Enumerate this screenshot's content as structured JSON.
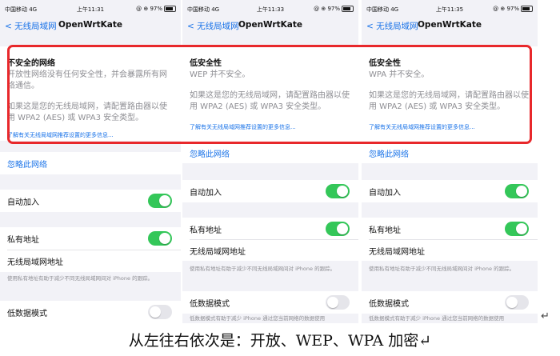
{
  "caption": "从左往右依次是：开放、WEP、WPA 加密↵",
  "return_mark": "↵",
  "colors": {
    "accent": "#1a73e8",
    "toggle_on": "#34c759",
    "highlight": "#e8282b"
  },
  "panels": [
    {
      "status": {
        "carrier": "中国移动 4G",
        "time": "上午11:31",
        "battery": "@ ⊕ 97%"
      },
      "nav": {
        "back": "< 无线局域网",
        "title": "OpenWrtKate"
      },
      "info": {
        "heading": "不安全的网络",
        "para1": "开放性网络没有任何安全性，并会暴露所有网络通信。",
        "para2": "如果这是您的无线局域网，请配置路由器以使用 WPA2 (AES) 或 WPA3 安全类型。",
        "link": "了解有关无线局域网推荐设置的更多信息..."
      },
      "ignore": "忽略此网络",
      "auto_join": "自动加入",
      "private_address": "私有地址",
      "wlan_address": "无线局域网地址",
      "private_note": "使用私有地址有助于减少不同无线局域网间对 iPhone 的跟踪。",
      "low_data": "低数据模式"
    },
    {
      "status": {
        "carrier": "中国移动 4G",
        "time": "上午11:33",
        "battery": "@ ⊕ 97%"
      },
      "nav": {
        "back": "< 无线局域网",
        "title": "OpenWrtKate"
      },
      "info": {
        "heading": "低安全性",
        "para1": "WEP 并不安全。",
        "para2": "如果这是您的无线局域网，请配置路由器以使用 WPA2 (AES) 或 WPA3 安全类型。",
        "link": "了解有关无线局域网推荐设置的更多信息..."
      },
      "ignore": "忽略此网络",
      "auto_join": "自动加入",
      "private_address": "私有地址",
      "wlan_address": "无线局域网地址",
      "private_note": "使用私有地址有助于减少不同无线局域网间对 iPhone 的跟踪。",
      "low_data": "低数据模式",
      "low_data_note": "低数据模式有助于减少 iPhone 通过您当前网络的数据使用"
    },
    {
      "status": {
        "carrier": "中国移动 4G",
        "time": "上午11:35",
        "battery": "@ ⊕ 97%"
      },
      "nav": {
        "back": "< 无线局域网",
        "title": "OpenWrtKate"
      },
      "info": {
        "heading": "低安全性",
        "para1": "WPA 并不安全。",
        "para2": "如果这是您的无线局域网，请配置路由器以使用 WPA2 (AES) 或 WPA3 安全类型。",
        "link": "了解有关无线局域网推荐设置的更多信息..."
      },
      "ignore": "忽略此网络",
      "auto_join": "自动加入",
      "private_address": "私有地址",
      "wlan_address": "无线局域网地址",
      "private_note": "使用私有地址有助于减少不同无线局域网间对 iPhone 的跟踪。",
      "low_data": "低数据模式",
      "low_data_note": "低数据模式有助于减少 iPhone 通过您当前网络的数据使用"
    }
  ]
}
